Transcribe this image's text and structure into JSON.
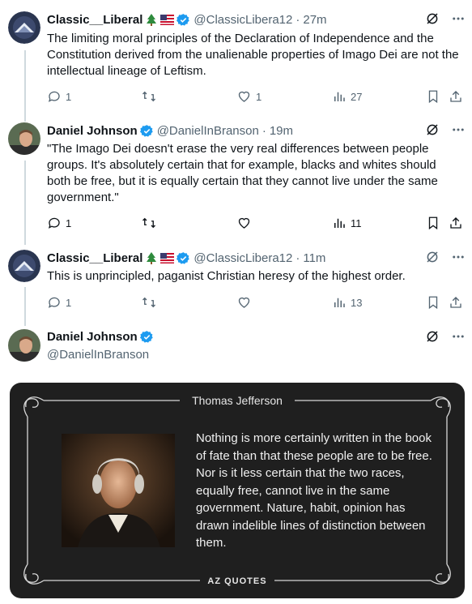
{
  "tweets": [
    {
      "name": "Classic__Liberal",
      "handle": "@ClassicLibera12",
      "time": "27m",
      "text": "The limiting moral principles of the Declaration of Independence and the Constitution derived from the unalienable properties of Imago Dei are not the intellectual lineage of Leftism.",
      "replies": "1",
      "retweets": "",
      "likes": "1",
      "views": "27"
    },
    {
      "name": "Daniel Johnson",
      "handle": "@DanielInBranson",
      "time": "19m",
      "text": "\"The Imago Dei doesn't erase the very real differences between people groups. It's absolutely certain that for example, blacks and whites should both be free, but it is equally certain that they cannot live under the same government.\"",
      "replies": "1",
      "retweets": "",
      "likes": "",
      "views": "11"
    },
    {
      "name": "Classic__Liberal",
      "handle": "@ClassicLibera12",
      "time": "11m",
      "text": "This is unprincipled, paganist Christian heresy of the highest order.",
      "replies": "1",
      "retweets": "",
      "likes": "",
      "views": "13"
    }
  ],
  "main_tweet": {
    "name": "Daniel Johnson",
    "handle": "@DanielInBranson"
  },
  "separator_dot": "·",
  "quote_image": {
    "author": "Thomas Jefferson",
    "text": "Nothing is more certainly written in the book of fate than that these people are to be free. Nor is it less certain that the two races, equally free, cannot live in the same government. Nature, habit, opinion has drawn indelible lines of distinction between them.",
    "logo": "AZ QUOTES"
  },
  "colors": {
    "verified": "#1d9bf0",
    "muted": "#536471",
    "thread_line": "#cfd9de",
    "card_bg": "#1f1f1f"
  },
  "icons": [
    "tree-emoji",
    "us-flag-emoji",
    "verified-badge",
    "grok-icon",
    "more-icon",
    "reply-icon",
    "retweet-icon",
    "like-icon",
    "views-icon",
    "bookmark-icon",
    "share-icon"
  ]
}
